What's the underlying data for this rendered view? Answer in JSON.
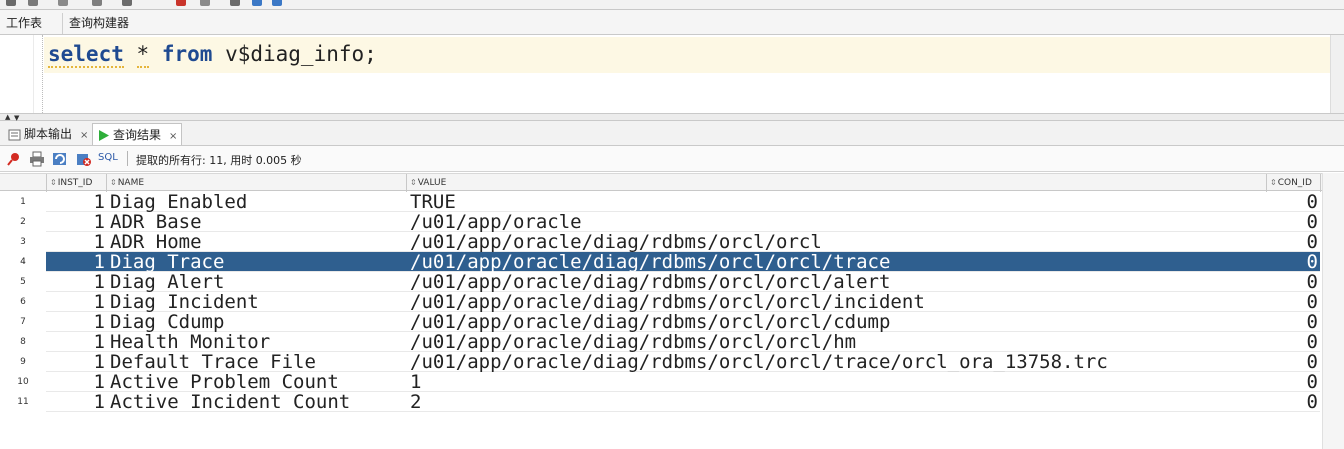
{
  "editor_tabs": [
    "工作表",
    "查询构建器"
  ],
  "sql": {
    "kw_select": "select",
    "star": "*",
    "kw_from": "from",
    "object": "v$diag_info",
    "terminator": ";"
  },
  "output_tabs": [
    {
      "label": "脚本输出",
      "close": "×"
    },
    {
      "label": "查询结果",
      "close": "×"
    }
  ],
  "result_toolbar": {
    "sql_label": "SQL",
    "status_text": "提取的所有行: 11, 用时 0.005 秒"
  },
  "grid": {
    "columns": [
      "INST_ID",
      "NAME",
      "VALUE",
      "CON_ID"
    ],
    "selected_row_index": 3,
    "rows": [
      {
        "num": "1",
        "inst_id": "1",
        "name": "Diag Enabled",
        "value": "TRUE",
        "con_id": "0"
      },
      {
        "num": "2",
        "inst_id": "1",
        "name": "ADR Base",
        "value": "/u01/app/oracle",
        "con_id": "0"
      },
      {
        "num": "3",
        "inst_id": "1",
        "name": "ADR Home",
        "value": "/u01/app/oracle/diag/rdbms/orcl/orcl",
        "con_id": "0"
      },
      {
        "num": "4",
        "inst_id": "1",
        "name": "Diag Trace",
        "value": "/u01/app/oracle/diag/rdbms/orcl/orcl/trace",
        "con_id": "0"
      },
      {
        "num": "5",
        "inst_id": "1",
        "name": "Diag Alert",
        "value": "/u01/app/oracle/diag/rdbms/orcl/orcl/alert",
        "con_id": "0"
      },
      {
        "num": "6",
        "inst_id": "1",
        "name": "Diag Incident",
        "value": "/u01/app/oracle/diag/rdbms/orcl/orcl/incident",
        "con_id": "0"
      },
      {
        "num": "7",
        "inst_id": "1",
        "name": "Diag Cdump",
        "value": "/u01/app/oracle/diag/rdbms/orcl/orcl/cdump",
        "con_id": "0"
      },
      {
        "num": "8",
        "inst_id": "1",
        "name": "Health Monitor",
        "value": "/u01/app/oracle/diag/rdbms/orcl/orcl/hm",
        "con_id": "0"
      },
      {
        "num": "9",
        "inst_id": "1",
        "name": "Default Trace File",
        "value": "/u01/app/oracle/diag/rdbms/orcl/orcl/trace/orcl_ora_13758.trc",
        "con_id": "0"
      },
      {
        "num": "10",
        "inst_id": "1",
        "name": "Active Problem Count",
        "value": "1",
        "con_id": "0"
      },
      {
        "num": "11",
        "inst_id": "1",
        "name": "Active Incident Count",
        "value": "2",
        "con_id": "0"
      }
    ]
  },
  "colors": {
    "keyword": "#1f4a91",
    "selection": "#2f5f8f",
    "current_line": "#fdf8e4"
  }
}
